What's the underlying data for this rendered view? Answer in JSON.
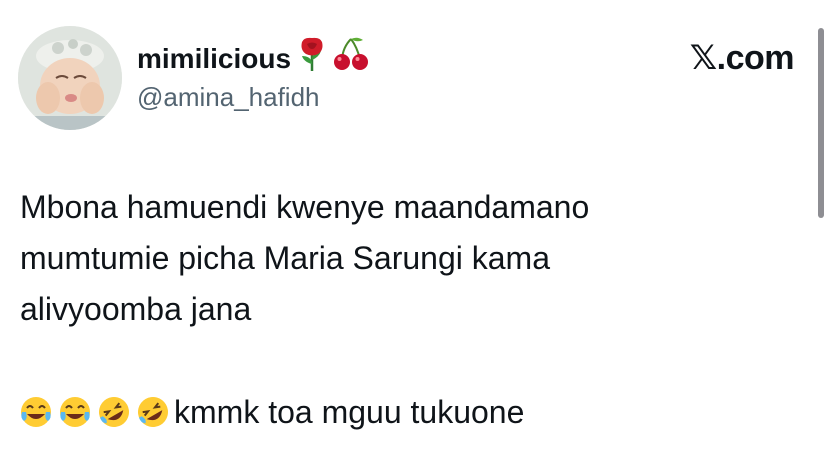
{
  "tweet": {
    "display_name": "mimilicious",
    "name_emojis": [
      "rose-emoji",
      "cherries-emoji"
    ],
    "handle": "@amina_hafidh",
    "brand": "𝕏.com",
    "body_text": "Mbona hamuendi kwenye maandamano\nmumtumie picha Maria Sarungi kama\nalivyoomba jana",
    "reaction_emojis": [
      "tears-of-joy-emoji",
      "tears-of-joy-emoji",
      "rolling-laughing-emoji",
      "rolling-laughing-emoji"
    ],
    "reaction_text": "kmmk toa mguu tukuone"
  },
  "colors": {
    "text": "#0f1419",
    "muted": "#536471",
    "rose": "#d01c2a",
    "cherry": "#c8102e",
    "emoji_face": "#ffcc33"
  }
}
